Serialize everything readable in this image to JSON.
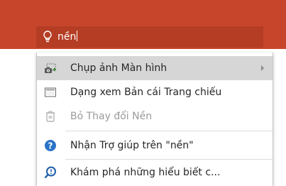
{
  "search": {
    "query": "nền"
  },
  "menu": {
    "items": [
      {
        "label": "Chụp ảnh Màn hình",
        "icon": "screenshot-camera-icon",
        "has_submenu": true,
        "enabled": true
      },
      {
        "label": "Dạng xem Bản cái Trang chiếu",
        "icon": "slide-master-view-icon",
        "has_submenu": false,
        "enabled": true
      },
      {
        "label": "Bỏ Thay đổi Nền",
        "icon": "reset-background-icon",
        "has_submenu": false,
        "enabled": false
      },
      {
        "label": "Nhận Trợ giúp trên \"nền\"",
        "icon": "help-question-icon",
        "has_submenu": false,
        "enabled": true
      },
      {
        "label": "Khám phá những hiểu biết c...",
        "icon": "smart-lookup-icon",
        "has_submenu": false,
        "enabled": true
      }
    ]
  },
  "colors": {
    "ribbon": "#c7462b",
    "search_box": "#b43d24",
    "highlight": "#d6d6d6",
    "help_icon": "#2b73c8"
  }
}
